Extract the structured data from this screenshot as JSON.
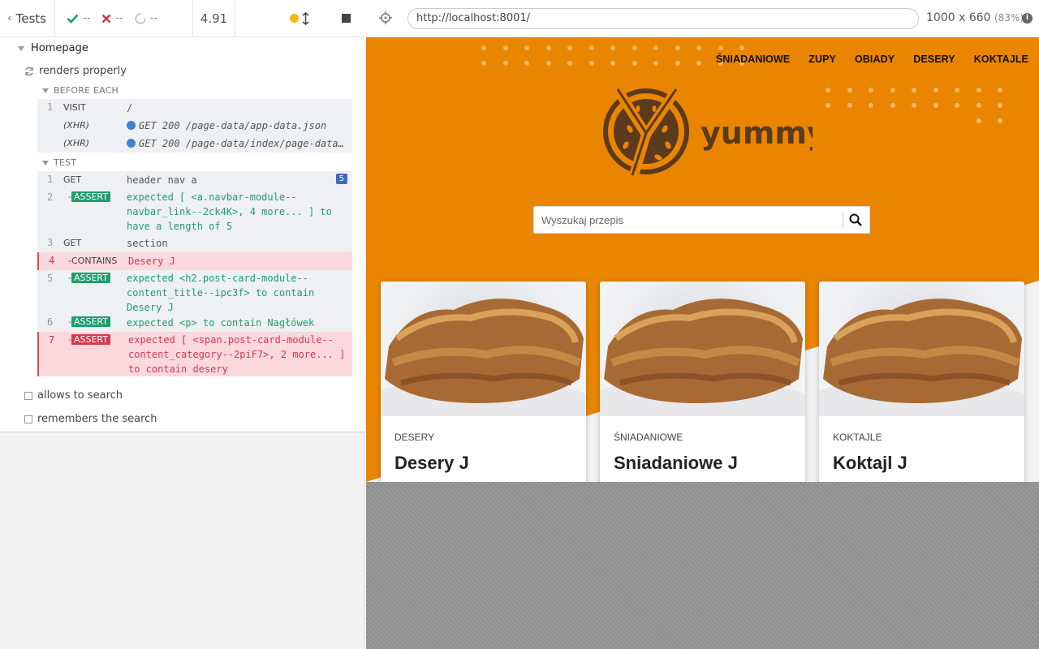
{
  "reporter": {
    "tests_label": "Tests",
    "passed": "--",
    "failed": "--",
    "pending": "--",
    "duration": "4.91",
    "suite": "Homepage",
    "tests": [
      {
        "title": "renders properly"
      },
      {
        "title": "allows to search"
      },
      {
        "title": "remembers the search"
      }
    ],
    "before_each_label": "BEFORE EACH",
    "test_label": "TEST",
    "before_each": [
      {
        "num": "1",
        "name": "VISIT",
        "msg": "/"
      },
      {
        "num": "",
        "name": "(XHR)",
        "msg": "GET 200 /page-data/app-data.json"
      },
      {
        "num": "",
        "name": "(XHR)",
        "msg": "GET 200 /page-data/index/page-data…"
      }
    ],
    "commands": {
      "c1": {
        "num": "1",
        "name": "GET",
        "msg": "header nav a",
        "count": "5"
      },
      "c2": {
        "num": "2",
        "name": "ASSERT",
        "msg": "expected [ <a.navbar-module--navbar_link--2ck4K>, 4 more... ] to have a length of 5"
      },
      "c3": {
        "num": "3",
        "name": "GET",
        "msg": "section"
      },
      "c4": {
        "num": "4",
        "name": "CONTAINS",
        "msg": "Desery J"
      },
      "c5": {
        "num": "5",
        "name": "ASSERT",
        "msg": "expected <h2.post-card-module--content_title--ipc3f> to contain Desery J"
      },
      "c6": {
        "num": "6",
        "name": "ASSERT",
        "msg": "expected <p> to contain Nagłówek"
      },
      "c7": {
        "num": "7",
        "name": "ASSERT",
        "msg": "expected [ <span.post-card-module--content_category--2piF7>, 2 more... ] to contain desery"
      }
    }
  },
  "aut": {
    "url": "http://localhost:8001/",
    "viewport": "1000 x 660",
    "scale": "(83%)",
    "nav": [
      "ŚNIADANIOWE",
      "ZUPY",
      "OBIADY",
      "DESERY",
      "KOKTAJLE"
    ],
    "logo_text": "yummy",
    "search_placeholder": "Wyszukaj przepis",
    "cards": [
      {
        "category": "DESERY",
        "title": "Desery J"
      },
      {
        "category": "ŚNIADANIOWE",
        "title": "Sniadaniowe J"
      },
      {
        "category": "KOKTAJLE",
        "title": "Koktajl J"
      }
    ],
    "colors": {
      "brand_orange": "#ea8500",
      "logo_brown": "#5b3a1e",
      "pass": "#1e9e6e",
      "fail": "#d5394e"
    }
  }
}
